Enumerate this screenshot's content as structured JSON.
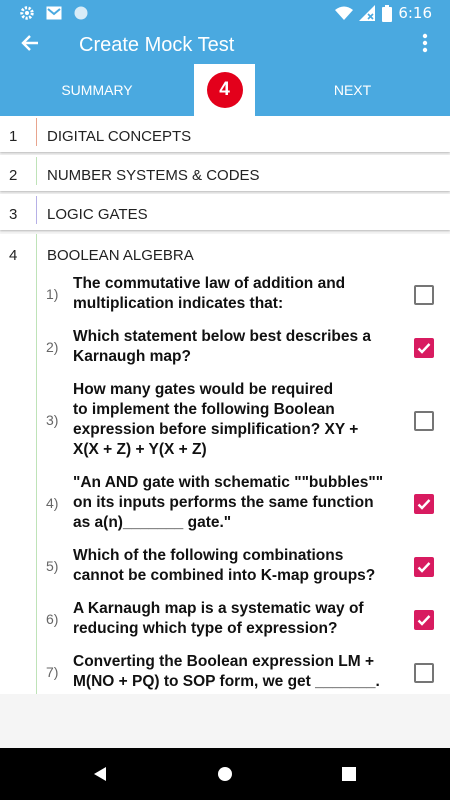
{
  "status_bar": {
    "time": "6:16",
    "left_icons": [
      "gear-icon",
      "mail-icon",
      "circle-icon"
    ],
    "right_icons": [
      "wifi-icon",
      "signal-icon",
      "battery-icon"
    ]
  },
  "app_bar": {
    "title": "Create Mock Test",
    "back_icon": "arrow-back-icon",
    "menu_icon": "more-vert-icon",
    "color": "#4aa9e0"
  },
  "tabs": {
    "summary_label": "SUMMARY",
    "current_step": "4",
    "next_label": "NEXT",
    "step_color": "#e3001b"
  },
  "chapters": [
    {
      "num": "1",
      "title": "DIGITAL CONCEPTS",
      "accent": "#e8a48e"
    },
    {
      "num": "2",
      "title": "NUMBER SYSTEMS & CODES",
      "accent": "#bfe3b8"
    },
    {
      "num": "3",
      "title": "LOGIC GATES",
      "accent": "#b6b0e6"
    },
    {
      "num": "4",
      "title": "BOOLEAN ALGEBRA",
      "accent": "#bfe3b8"
    }
  ],
  "questions": [
    {
      "num": "1)",
      "lines": [
        "The commutative law of addition and",
        "multiplication indicates that:"
      ],
      "checked": false
    },
    {
      "num": "2)",
      "lines": [
        "Which statement below best describes a",
        "Karnaugh map?"
      ],
      "checked": true
    },
    {
      "num": "3)",
      "lines": [
        "How many gates would be required",
        "to implement the following Boolean",
        "expression before simplification? XY +",
        "X(X + Z) + Y(X + Z)"
      ],
      "checked": false
    },
    {
      "num": "4)",
      "lines": [
        "\"An AND gate with schematic \"\"bubbles\"\"",
        "on its inputs performs the same function",
        "as a(n)_______ gate.\""
      ],
      "checked": true
    },
    {
      "num": "5)",
      "lines": [
        "Which of the following combinations",
        "cannot be combined into K-map groups?"
      ],
      "checked": true
    },
    {
      "num": "6)",
      "lines": [
        "A Karnaugh map is a systematic way of",
        "reducing which type of expression?"
      ],
      "checked": true
    },
    {
      "num": "7)",
      "lines": [
        "Converting the Boolean expression LM +",
        "M(NO + PQ) to SOP form, we get _______."
      ],
      "checked": false
    }
  ],
  "check_color": "#d81b60",
  "nav_bar": [
    "back-triangle-icon",
    "home-circle-icon",
    "recents-square-icon"
  ]
}
